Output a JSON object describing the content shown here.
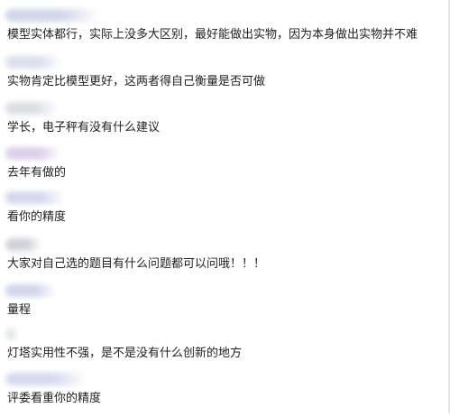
{
  "messages": [
    {
      "sender": "",
      "text": "模型实体都行，实际上没多大区别，最好能做出实物，因为本身做出实物并不难",
      "name_color": "#c9cfe6"
    },
    {
      "sender": "",
      "text": "实物肯定比模型更好，这两者得自己衡量是否可做",
      "name_color": "#d6d9e8"
    },
    {
      "sender": "",
      "text": "学长，电子秤有没有什么建议",
      "name_color": "#d7d9e0"
    },
    {
      "sender": "",
      "text": "去年有做的",
      "name_color": "#d5c8e6"
    },
    {
      "sender": "",
      "text": "看你的精度",
      "name_color": "#cdd2ea"
    },
    {
      "sender": "",
      "text": "大家对自己选的题目有什么问题都可以问哦！！！",
      "name_color": "#c8cad3"
    },
    {
      "sender": "",
      "text": "量程",
      "name_color": "#c9cfe9"
    },
    {
      "sender": "",
      "text": "灯塔实用性不强，是不是没有什么创新的地方",
      "name_color": "#e0e2ea"
    },
    {
      "sender": "",
      "text": "评委看重你的精度",
      "name_color": "#cfd3ea"
    }
  ]
}
